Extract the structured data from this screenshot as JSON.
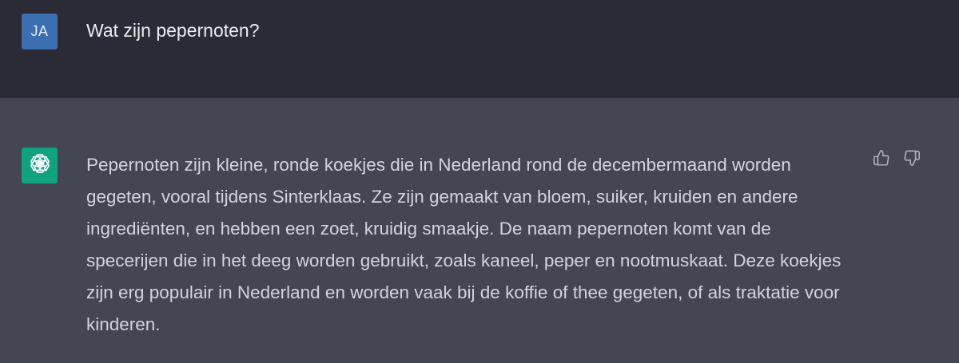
{
  "user_message": {
    "avatar_initials": "JA",
    "text": "Wat zijn pepernoten?"
  },
  "assistant_message": {
    "avatar_icon": "openai-logo-icon",
    "text": "Pepernoten zijn kleine, ronde koekjes die in Nederland rond de decembermaand worden gegeten, vooral tijdens Sinterklaas. Ze zijn gemaakt van bloem, suiker, kruiden en andere ingrediënten, en hebben een zoet, kruidig smaakje. De naam pepernoten komt van de specerijen die in het deeg worden gebruikt, zoals kaneel, peper en nootmuskaat. Deze koekjes zijn erg populair in Nederland en worden vaak bij de koffie of thee gegeten, of als traktatie voor kinderen.",
    "feedback_icons": [
      "thumbs-up-icon",
      "thumbs-down-icon"
    ]
  },
  "colors": {
    "user_row_bg": "#2b2b35",
    "assistant_row_bg": "#444654",
    "user_avatar_bg": "#3a6fb1",
    "bot_avatar_bg": "#10a37f"
  }
}
